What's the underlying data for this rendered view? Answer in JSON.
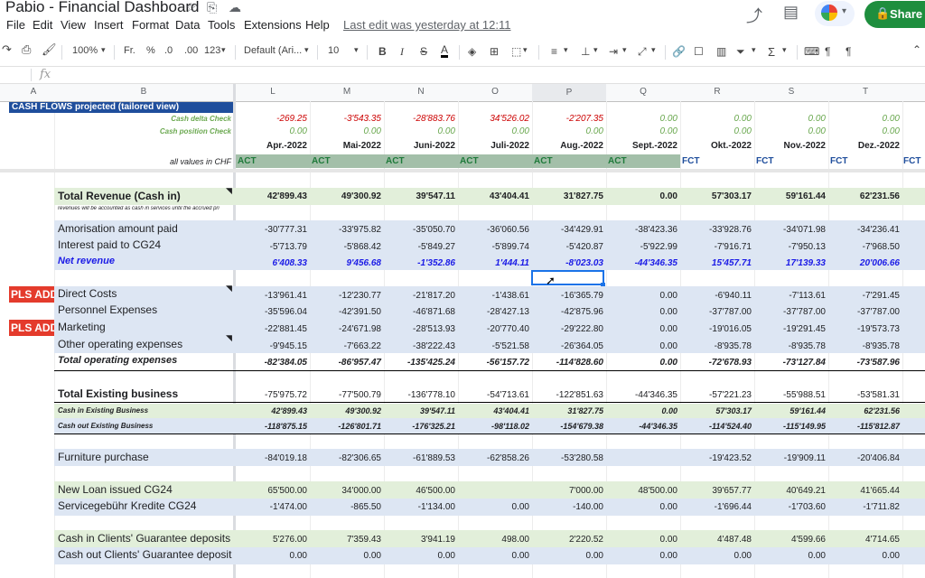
{
  "app": {
    "title": "Pabio - Financial Dashboard",
    "last_edit": "Last edit was yesterday at 12:11",
    "share_label": "Share"
  },
  "menu": [
    "File",
    "Edit",
    "View",
    "Insert",
    "Format",
    "Data",
    "Tools",
    "Extensions",
    "Help"
  ],
  "toolbar": {
    "zoom": "100%",
    "currency": "Fr.",
    "percent": "%",
    "dec_less": ".0",
    "dec_more": ".00",
    "more_formats": "123",
    "font": "Default (Ari...",
    "font_size": "10",
    "bold": "B",
    "italic": "I",
    "strike": "S",
    "text_color": "A"
  },
  "formula_bar": {
    "fx": "fx"
  },
  "columns": {
    "left": [
      "A",
      "B"
    ],
    "right": [
      "L",
      "M",
      "N",
      "O",
      "P",
      "Q",
      "R",
      "S",
      "T"
    ]
  },
  "header_block": {
    "title": "CASH FLOWS projected (tailored view)",
    "cash_delta_label": "Cash delta Check",
    "cash_position_label": "Cash position Check",
    "values_note": "all values in CHF",
    "cash_delta": [
      "-269.25",
      "-3'543.35",
      "-28'883.76",
      "34'526.02",
      "-2'207.35",
      "0.00",
      "0.00",
      "0.00",
      "0.00"
    ],
    "cash_position": [
      "0.00",
      "0.00",
      "0.00",
      "0.00",
      "0.00",
      "0.00",
      "0.00",
      "0.00",
      "0.00"
    ],
    "months": [
      "Apr.-2022",
      "Mai-2022",
      "Juni-2022",
      "Juli-2022",
      "Aug.-2022",
      "Sept.-2022",
      "Okt.-2022",
      "Nov.-2022",
      "Dez.-2022"
    ],
    "act_fct": [
      "ACT",
      "ACT",
      "ACT",
      "ACT",
      "ACT",
      "ACT",
      "FCT",
      "FCT",
      "FCT",
      "FCT"
    ]
  },
  "rows": {
    "total_revenue": {
      "label": "Total Revenue (Cash in)",
      "values": [
        "42'899.43",
        "49'300.92",
        "39'547.11",
        "43'404.41",
        "31'827.75",
        "0.00",
        "57'303.17",
        "59'161.44",
        "62'231.56"
      ]
    },
    "revenue_note": "revenues will be accounted as cash in services until the accrued pri",
    "amortisation": {
      "label": "Amorisation amount paid",
      "values": [
        "-30'777.31",
        "-33'975.82",
        "-35'050.70",
        "-36'060.56",
        "-34'429.91",
        "-38'423.36",
        "-33'928.76",
        "-34'071.98",
        "-34'236.41"
      ]
    },
    "interest": {
      "label": "Interest paid to CG24",
      "values": [
        "-5'713.79",
        "-5'868.42",
        "-5'849.27",
        "-5'899.74",
        "-5'420.87",
        "-5'922.99",
        "-7'916.71",
        "-7'950.13",
        "-7'968.50"
      ]
    },
    "net_revenue": {
      "label": "Net revenue",
      "values": [
        "6'408.33",
        "9'456.68",
        "-1'352.86",
        "1'444.11",
        "-8'023.03",
        "-44'346.35",
        "15'457.71",
        "17'139.33",
        "20'006.66"
      ]
    },
    "pls_add": "PLS ADD",
    "direct_costs": {
      "label": "Direct Costs",
      "values": [
        "-13'961.41",
        "-12'230.77",
        "-21'817.20",
        "-1'438.61",
        "-16'365.79",
        "0.00",
        "-6'940.11",
        "-7'113.61",
        "-7'291.45"
      ]
    },
    "personnel": {
      "label": "Personnel Expenses",
      "values": [
        "-35'596.04",
        "-42'391.50",
        "-46'871.68",
        "-28'427.13",
        "-42'875.96",
        "0.00",
        "-37'787.00",
        "-37'787.00",
        "-37'787.00"
      ]
    },
    "marketing": {
      "label": "Marketing",
      "values": [
        "-22'881.45",
        "-24'671.98",
        "-28'513.93",
        "-20'770.40",
        "-29'222.80",
        "0.00",
        "-19'016.05",
        "-19'291.45",
        "-19'573.73"
      ]
    },
    "other_opex": {
      "label": "Other operating expenses",
      "values": [
        "-9'945.15",
        "-7'663.22",
        "-38'222.43",
        "-5'521.58",
        "-26'364.05",
        "0.00",
        "-8'935.78",
        "-8'935.78",
        "-8'935.78"
      ]
    },
    "total_opex": {
      "label": "Total operating expenses",
      "values": [
        "-82'384.05",
        "-86'957.47",
        "-135'425.24",
        "-56'157.72",
        "-114'828.60",
        "0.00",
        "-72'678.93",
        "-73'127.84",
        "-73'587.96"
      ]
    },
    "total_existing": {
      "label": "Total Existing business",
      "values": [
        "-75'975.72",
        "-77'500.79",
        "-136'778.10",
        "-54'713.61",
        "-122'851.63",
        "-44'346.35",
        "-57'221.23",
        "-55'988.51",
        "-53'581.31"
      ]
    },
    "cash_in_existing": {
      "label": "Cash in Existing Business",
      "values": [
        "42'899.43",
        "49'300.92",
        "39'547.11",
        "43'404.41",
        "31'827.75",
        "0.00",
        "57'303.17",
        "59'161.44",
        "62'231.56"
      ]
    },
    "cash_out_existing": {
      "label": "Cash out Existing Business",
      "values": [
        "-118'875.15",
        "-126'801.71",
        "-176'325.21",
        "-98'118.02",
        "-154'679.38",
        "-44'346.35",
        "-114'524.40",
        "-115'149.95",
        "-115'812.87"
      ]
    },
    "furniture": {
      "label": "Furniture purchase",
      "values": [
        "-84'019.18",
        "-82'306.65",
        "-61'889.53",
        "-62'858.26",
        "-53'280.58",
        "",
        "-19'423.52",
        "-19'909.11",
        "-20'406.84"
      ]
    },
    "new_loan": {
      "label": "New Loan issued CG24",
      "values": [
        "65'500.00",
        "34'000.00",
        "46'500.00",
        "",
        "7'000.00",
        "48'500.00",
        "39'657.77",
        "40'649.21",
        "41'665.44"
      ]
    },
    "service_fee": {
      "label": "Servicegebühr Kredite CG24",
      "values": [
        "-1'474.00",
        "-865.50",
        "-1'134.00",
        "0.00",
        "-140.00",
        "0.00",
        "-1'696.44",
        "-1'703.60",
        "-1'711.82"
      ]
    },
    "cash_in_guarantee": {
      "label": "Cash in Clients' Guarantee deposits",
      "values": [
        "5'276.00",
        "7'359.43",
        "3'941.19",
        "498.00",
        "2'220.52",
        "0.00",
        "4'487.48",
        "4'599.66",
        "4'714.65"
      ]
    },
    "cash_out_guarantee": {
      "label": "Cash out Clients' Guarantee deposit",
      "values": [
        "0.00",
        "0.00",
        "0.00",
        "0.00",
        "0.00",
        "0.00",
        "0.00",
        "0.00",
        "0.00"
      ]
    }
  },
  "colors": {
    "accent_green": "#1e8e3e",
    "header_blue": "#1f4e9c",
    "fill_green": "#e2efda",
    "fill_blue": "#dde6f3",
    "pls_red": "#e43b2c"
  }
}
